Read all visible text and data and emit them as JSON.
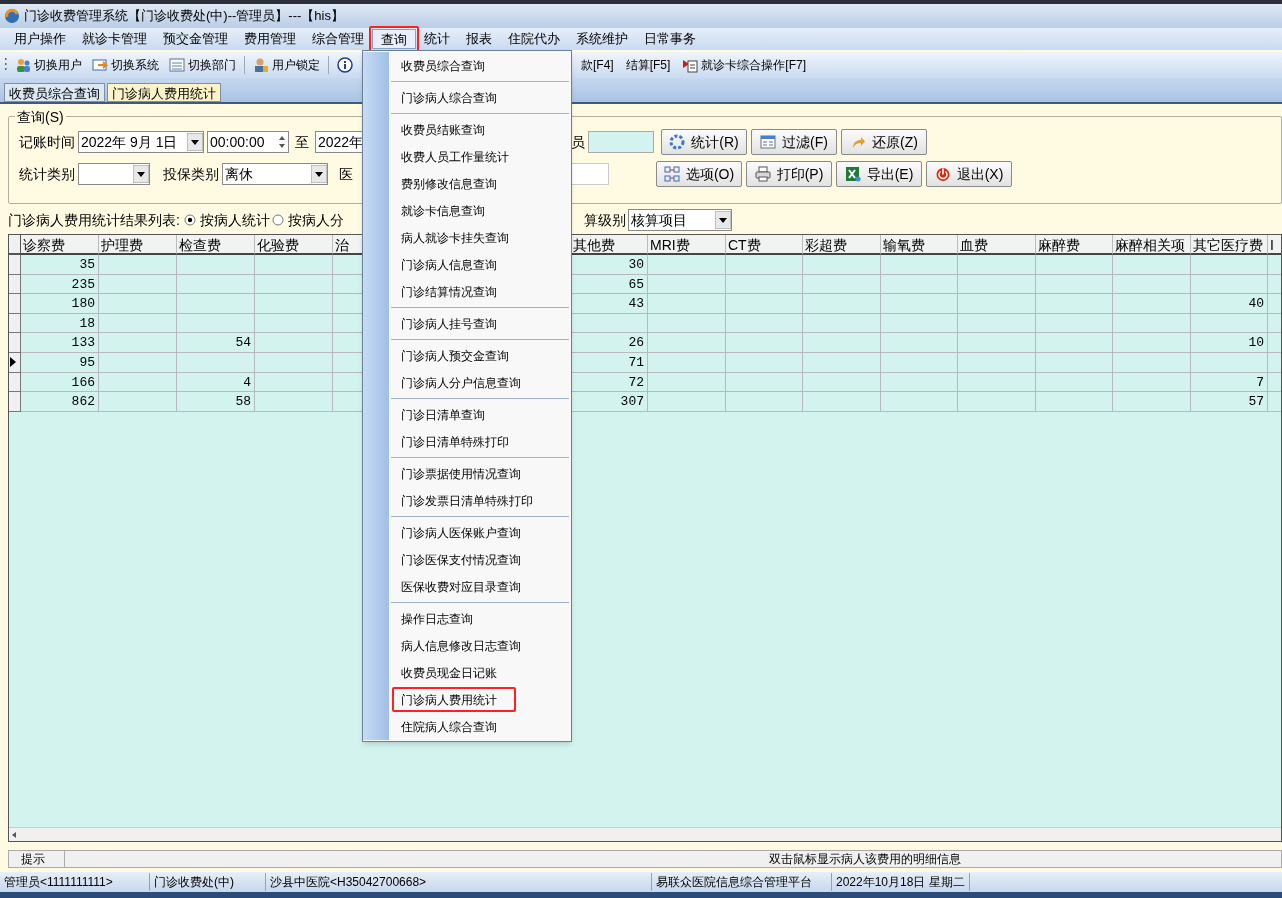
{
  "window": {
    "title": "门诊收费管理系统【门诊收费处(中)--管理员】---【his】"
  },
  "menubar": [
    {
      "label": "用户操作",
      "selected": false
    },
    {
      "label": "就诊卡管理",
      "selected": false
    },
    {
      "label": "预交金管理",
      "selected": false
    },
    {
      "label": "费用管理",
      "selected": false
    },
    {
      "label": "综合管理",
      "selected": false
    },
    {
      "label": "查询",
      "selected": true
    },
    {
      "label": "统计",
      "selected": false
    },
    {
      "label": "报表",
      "selected": false
    },
    {
      "label": "住院代办",
      "selected": false
    },
    {
      "label": "系统维护",
      "selected": false
    },
    {
      "label": "日常事务",
      "selected": false
    }
  ],
  "toolbar": {
    "left": [
      {
        "kind": "users",
        "label": "切换用户"
      },
      {
        "kind": "system",
        "label": "切换系统"
      },
      {
        "kind": "department",
        "label": "切换部门"
      },
      {
        "kind": "sep"
      },
      {
        "kind": "lock",
        "label": "用户锁定"
      },
      {
        "kind": "sep"
      },
      {
        "kind": "info"
      }
    ],
    "right": [
      {
        "kind": "text",
        "label": "款[F4]"
      },
      {
        "kind": "text",
        "label": "结算[F5]"
      },
      {
        "kind": "card",
        "label": "就诊卡综合操作[F7]"
      }
    ]
  },
  "tabs": [
    {
      "label": "收费员综合查询",
      "selected": false
    },
    {
      "label": "门诊病人费用统计",
      "selected": true
    }
  ],
  "query": {
    "legend": "查询(S)",
    "time_label": "记账时间",
    "date_from": "2022年 9月 1日",
    "time_from": "00:00:00",
    "to_label": "至",
    "date_to": "2022年",
    "operator_label": "员",
    "category_label": "统计类别",
    "insurance_label": "投保类别",
    "insurance_value": "离休",
    "hospital_label": "医",
    "buttons": [
      [
        {
          "kind": "refresh",
          "label": "统计(R)"
        },
        {
          "kind": "filter",
          "label": "过滤(F)"
        },
        {
          "kind": "undo",
          "label": "还原(Z)"
        }
      ],
      [
        {
          "kind": "options",
          "label": "选项(O)"
        },
        {
          "kind": "print",
          "label": "打印(P)"
        },
        {
          "kind": "excel",
          "label": "导出(E)"
        },
        {
          "kind": "exit",
          "label": "退出(X)"
        }
      ]
    ]
  },
  "result": {
    "label": "门诊病人费用统计结果列表:",
    "modes": [
      {
        "label": "按病人统计",
        "selected": true
      },
      {
        "label": "按病人分",
        "selected": false
      }
    ],
    "level_label": "算级别",
    "level_value": "核算项目"
  },
  "table": {
    "columns": [
      "诊察费",
      "护理费",
      "检查费",
      "化验费",
      "治",
      "其他费",
      "MRI费",
      "CT费",
      "彩超费",
      "输氧费",
      "血费",
      "麻醉费",
      "麻醉相关项",
      "其它医疗费",
      "I"
    ],
    "rows": [
      {
        "selected": false,
        "cells": [
          "35",
          null,
          null,
          null,
          null,
          "30",
          null,
          null,
          null,
          null,
          null,
          null,
          null,
          null,
          null
        ]
      },
      {
        "selected": false,
        "cells": [
          "235",
          null,
          null,
          null,
          null,
          "65",
          null,
          null,
          null,
          null,
          null,
          null,
          null,
          null,
          null
        ]
      },
      {
        "selected": false,
        "cells": [
          "180",
          null,
          null,
          null,
          null,
          "43",
          null,
          null,
          null,
          null,
          null,
          null,
          null,
          "40",
          null
        ]
      },
      {
        "selected": false,
        "cells": [
          "18",
          null,
          null,
          null,
          null,
          null,
          null,
          null,
          null,
          null,
          null,
          null,
          null,
          null,
          null
        ]
      },
      {
        "selected": false,
        "cells": [
          "133",
          null,
          "54",
          null,
          null,
          "26",
          null,
          null,
          null,
          null,
          null,
          null,
          null,
          "10",
          null
        ]
      },
      {
        "selected": true,
        "cells": [
          "95",
          null,
          null,
          null,
          null,
          "71",
          null,
          null,
          null,
          null,
          null,
          null,
          null,
          null,
          null
        ]
      },
      {
        "selected": false,
        "cells": [
          "166",
          null,
          "4",
          null,
          null,
          "72",
          null,
          null,
          null,
          null,
          null,
          null,
          null,
          "7",
          null
        ]
      },
      {
        "selected": false,
        "cells": [
          "862",
          null,
          "58",
          null,
          null,
          "307",
          null,
          null,
          null,
          null,
          null,
          null,
          null,
          "57",
          null
        ]
      }
    ]
  },
  "hint": {
    "label": "提示",
    "text": "双击鼠标显示病人该费用的明细信息"
  },
  "status_bar": [
    "管理员<1111111111>",
    "门诊收费处(中)",
    "沙县中医院<H35042700668>",
    "易联众医院信息综合管理平台",
    "2022年10月18日 星期二"
  ],
  "dropdown": {
    "groups": [
      [
        {
          "label": "收费员综合查询",
          "highlighted": false
        }
      ],
      [
        {
          "label": "门诊病人综合查询",
          "highlighted": false
        }
      ],
      [
        {
          "label": "收费员结账查询",
          "highlighted": false
        },
        {
          "label": "收费人员工作量统计",
          "highlighted": false
        },
        {
          "label": "费别修改信息查询",
          "highlighted": false
        },
        {
          "label": "就诊卡信息查询",
          "highlighted": false
        },
        {
          "label": "病人就诊卡挂失查询",
          "highlighted": false
        },
        {
          "label": "门诊病人信息查询",
          "highlighted": false
        },
        {
          "label": "门诊结算情况查询",
          "highlighted": false
        }
      ],
      [
        {
          "label": "门诊病人挂号查询",
          "highlighted": false
        }
      ],
      [
        {
          "label": "门诊病人预交金查询",
          "highlighted": false
        },
        {
          "label": "门诊病人分户信息查询",
          "highlighted": false
        }
      ],
      [
        {
          "label": "门诊日清单查询",
          "highlighted": false
        },
        {
          "label": "门诊日清单特殊打印",
          "highlighted": false
        }
      ],
      [
        {
          "label": "门诊票据使用情况查询",
          "highlighted": false
        },
        {
          "label": "门诊发票日清单特殊打印",
          "highlighted": false
        }
      ],
      [
        {
          "label": "门诊病人医保账户查询",
          "highlighted": false
        },
        {
          "label": "门诊医保支付情况查询",
          "highlighted": false
        },
        {
          "label": "医保收费对应目录查询",
          "highlighted": false
        }
      ],
      [
        {
          "label": "操作日志查询",
          "highlighted": false
        },
        {
          "label": "病人信息修改日志查询",
          "highlighted": false
        },
        {
          "label": "收费员现金日记账",
          "highlighted": false
        },
        {
          "label": "门诊病人费用统计",
          "highlighted": true
        },
        {
          "label": "住院病人综合查询",
          "highlighted": false
        }
      ]
    ]
  }
}
